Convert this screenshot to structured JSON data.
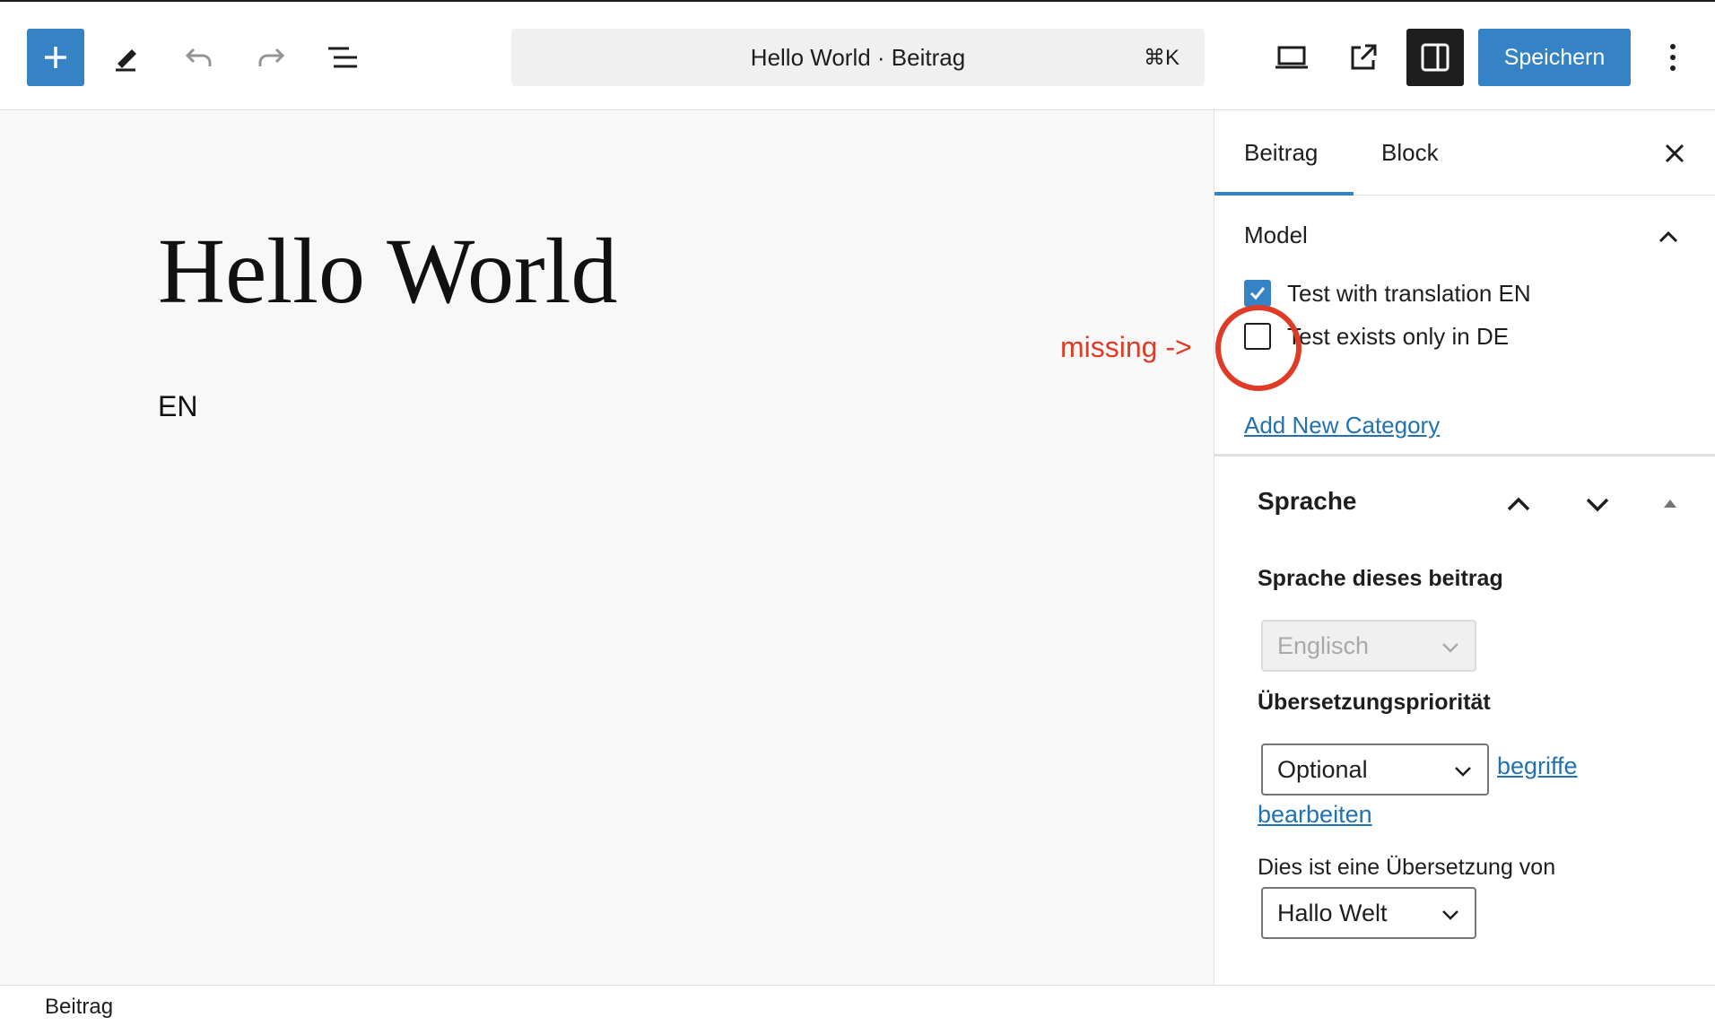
{
  "toolbar": {
    "add_label": "+",
    "command_bar_text": "Hello World · Beitrag",
    "command_shortcut": "⌘K",
    "save_label": "Speichern"
  },
  "icons": {
    "add": "plus-icon",
    "tools": "pencil-icon",
    "undo": "undo-icon",
    "redo": "redo-icon",
    "outline": "list-view-icon",
    "preview": "desktop-view-icon",
    "external": "external-link-icon",
    "settings": "sidebar-toggle-icon",
    "more": "kebab-menu-icon"
  },
  "colors": {
    "accent": "#3582c4",
    "link": "#2271b1",
    "annotation": "#e03b24"
  },
  "canvas": {
    "title": "Hello World",
    "paragraph": "EN",
    "annotation": "missing ->"
  },
  "sidebar": {
    "tabs": [
      {
        "label": "Beitrag",
        "active": true
      },
      {
        "label": "Block",
        "active": false
      }
    ],
    "model_panel": {
      "title": "Model",
      "categories": [
        {
          "label": "Test with translation EN",
          "checked": true
        },
        {
          "label": "Test exists only in DE",
          "checked": false
        }
      ],
      "add_link": "Add New Category"
    },
    "language_panel": {
      "title": "Sprache",
      "language_label": "Sprache dieses beitrag",
      "language_value": "Englisch",
      "priority_label": "Übersetzungspriorität",
      "priority_value": "Optional",
      "edit_link_1": "begriffe",
      "edit_link_2": "bearbeiten",
      "translation_label": "Dies ist eine Übersetzung von",
      "translation_value": "Hallo Welt"
    }
  },
  "footer": {
    "breadcrumb": "Beitrag"
  }
}
